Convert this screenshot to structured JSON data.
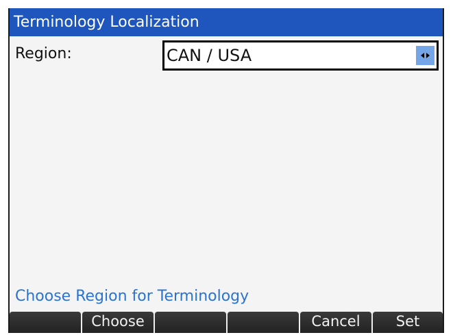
{
  "window": {
    "title": "Terminology Localization"
  },
  "form": {
    "region_label": "Region:",
    "region_value": "CAN / USA",
    "region_arrows_icon": "left-right-arrows-icon"
  },
  "status": {
    "hint": "Choose Region for Terminology"
  },
  "softkeys": {
    "key1": "",
    "key2": "Choose",
    "key3": "",
    "key4": "",
    "key5": "Cancel",
    "key6": "Set"
  },
  "colors": {
    "title_bar": "#1f56bd",
    "hint_text": "#2a73d1",
    "selector_arrows": "#74a6e7",
    "softkey_bg": "#222222"
  }
}
